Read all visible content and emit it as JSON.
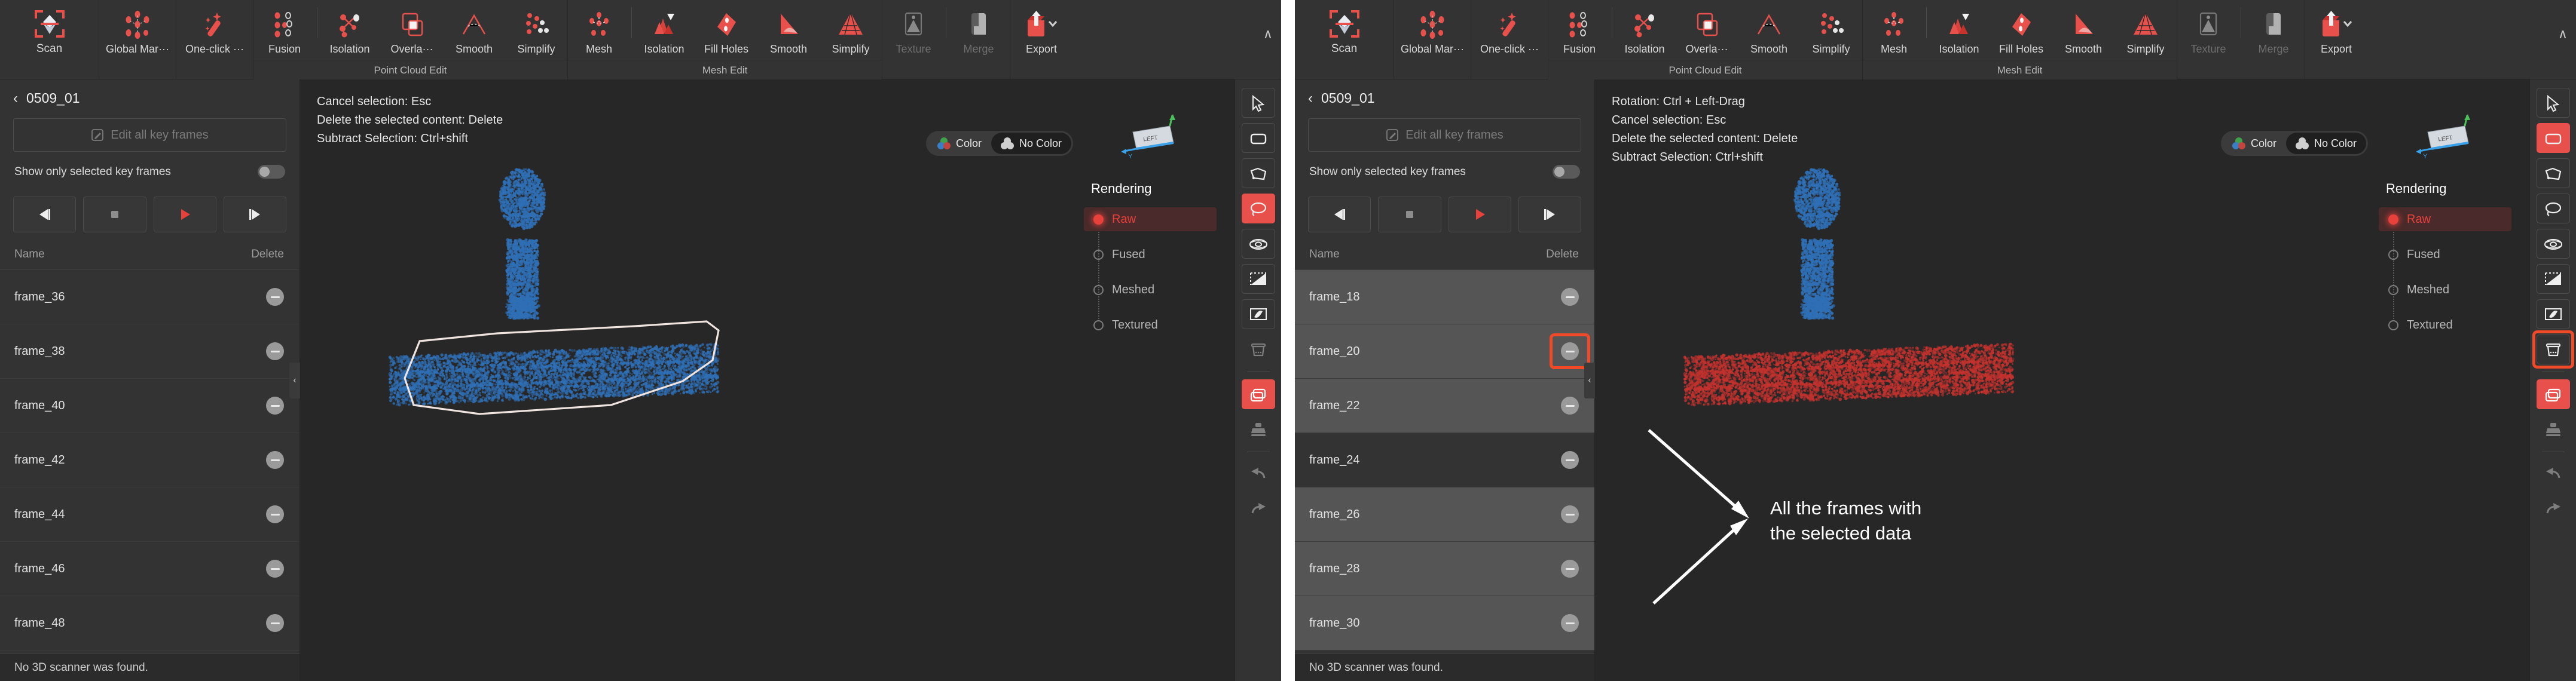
{
  "app": {
    "ribbon": {
      "scan": {
        "label": "Scan",
        "icon": "scan-frame-icon"
      },
      "groups": [
        {
          "caption": "",
          "items": [
            {
              "label": "Global Mar···",
              "icon": "global-marker-icon",
              "disabled": false
            },
            {
              "label": "One-click ···",
              "icon": "magic-wand-icon",
              "disabled": false
            }
          ]
        },
        {
          "caption": "Point Cloud Edit",
          "items": [
            {
              "label": "Fusion",
              "icon": "fusion-points-icon",
              "disabled": false,
              "sep_after": true
            },
            {
              "label": "Isolation",
              "icon": "isolation-nodes-icon",
              "disabled": false
            },
            {
              "label": "Overla···",
              "icon": "overlap-squares-icon",
              "disabled": false
            },
            {
              "label": "Smooth",
              "icon": "smooth-peak-icon",
              "disabled": false
            },
            {
              "label": "Simplify",
              "icon": "simplify-dots-icon",
              "disabled": false
            }
          ]
        },
        {
          "caption": "Mesh Edit",
          "items": [
            {
              "label": "Mesh",
              "icon": "mesh-points-icon",
              "disabled": false,
              "sep_after": true
            },
            {
              "label": "Isolation",
              "icon": "mesh-isolation-icon",
              "disabled": false
            },
            {
              "label": "Fill Holes",
              "icon": "fill-holes-icon",
              "disabled": false
            },
            {
              "label": "Smooth",
              "icon": "mesh-smooth-icon",
              "disabled": false
            },
            {
              "label": "Simplify",
              "icon": "mesh-simplify-icon",
              "disabled": false
            }
          ]
        },
        {
          "caption": "",
          "items": [
            {
              "label": "Texture",
              "icon": "texture-icon",
              "disabled": true,
              "sep_after": true
            },
            {
              "label": "Merge",
              "icon": "merge-icon",
              "disabled": true
            }
          ]
        },
        {
          "caption": "",
          "items": [
            {
              "label": "Export",
              "icon": "export-icon",
              "disabled": false,
              "has_caret": true
            }
          ]
        }
      ],
      "collapse_icon": "chevron-up-icon"
    },
    "accent_red": "#e8413c",
    "highlight_orange": "#f04a28"
  },
  "left": {
    "panel": {
      "title": "0509_01",
      "back_icon": "chevron-left-icon",
      "edit_all_label": "Edit all key frames",
      "edit_all_icon": "pencil-square-icon",
      "toggle_label": "Show only selected key frames",
      "toggle_on": false,
      "transport": [
        {
          "name": "step-back-button",
          "icon": "step-backward-icon"
        },
        {
          "name": "stop-button",
          "icon": "stop-square-icon"
        },
        {
          "name": "play-button",
          "icon": "play-triangle-icon"
        },
        {
          "name": "step-forward-button",
          "icon": "step-forward-icon"
        }
      ],
      "columns": {
        "name": "Name",
        "delete": "Delete"
      },
      "rows": [
        {
          "name": "frame_36",
          "selected": false
        },
        {
          "name": "frame_38",
          "selected": false
        },
        {
          "name": "frame_40",
          "selected": false
        },
        {
          "name": "frame_42",
          "selected": false
        },
        {
          "name": "frame_44",
          "selected": false
        },
        {
          "name": "frame_46",
          "selected": false
        },
        {
          "name": "frame_48",
          "selected": false
        }
      ],
      "status": "No 3D scanner was found."
    },
    "viewport": {
      "hints": [
        "Cancel selection: Esc",
        "Delete the selected content: Delete",
        "Subtract Selection: Ctrl+shift"
      ],
      "color_toggle": {
        "color_label": "Color",
        "nocolor_label": "No Color",
        "active": "No Color"
      },
      "gizmo_label": "LEFT",
      "rendering": {
        "title": "Rendering",
        "options": [
          {
            "label": "Raw",
            "selected": true
          },
          {
            "label": "Fused",
            "selected": false
          },
          {
            "label": "Meshed",
            "selected": false
          },
          {
            "label": "Textured",
            "selected": false
          }
        ]
      },
      "point_cloud_color": "#2f6fb5",
      "lasso_visible": true
    },
    "vbar": [
      {
        "name": "cursor-select-tool",
        "icon": "cursor-arrow-icon",
        "state": "normal"
      },
      {
        "name": "rectangle-select-tool",
        "icon": "rectangle-icon",
        "state": "normal"
      },
      {
        "name": "polygon-select-tool",
        "icon": "polygon-icon",
        "state": "normal"
      },
      {
        "name": "lasso-select-tool",
        "icon": "lasso-icon",
        "state": "active"
      },
      {
        "name": "brush-select-tool",
        "icon": "brush-ellipse-icon",
        "state": "normal"
      },
      {
        "name": "plane-cut-tool",
        "icon": "plane-cut-icon",
        "state": "normal"
      },
      {
        "name": "flip-tool",
        "icon": "flip-icon",
        "state": "normal"
      },
      {
        "name": "delete-tool",
        "icon": "trash-icon",
        "state": "disabled"
      },
      {
        "name": "frames-panel-toggle",
        "icon": "stacked-frames-icon",
        "state": "active"
      },
      {
        "name": "stamp-tool",
        "icon": "stamp-icon",
        "state": "disabled"
      },
      {
        "name": "undo-button",
        "icon": "undo-arrow-icon",
        "state": "disabled"
      },
      {
        "name": "redo-button",
        "icon": "redo-arrow-icon",
        "state": "disabled"
      }
    ]
  },
  "right": {
    "panel": {
      "title": "0509_01",
      "back_icon": "chevron-left-icon",
      "edit_all_label": "Edit all key frames",
      "edit_all_icon": "pencil-square-icon",
      "toggle_label": "Show only selected key frames",
      "toggle_on": false,
      "transport": [
        {
          "name": "step-back-button",
          "icon": "step-backward-icon"
        },
        {
          "name": "stop-button",
          "icon": "stop-square-icon"
        },
        {
          "name": "play-button",
          "icon": "play-triangle-icon"
        },
        {
          "name": "step-forward-button",
          "icon": "step-forward-icon"
        }
      ],
      "columns": {
        "name": "Name",
        "delete": "Delete"
      },
      "rows": [
        {
          "name": "frame_18",
          "selected": true
        },
        {
          "name": "frame_20",
          "selected": true,
          "delete_highlighted": true
        },
        {
          "name": "frame_22",
          "selected": true
        },
        {
          "name": "frame_24",
          "selected": false
        },
        {
          "name": "frame_26",
          "selected": true
        },
        {
          "name": "frame_28",
          "selected": true
        },
        {
          "name": "frame_30",
          "selected": true
        }
      ],
      "status": "No 3D scanner was found."
    },
    "viewport": {
      "hints": [
        "Rotation: Ctrl + Left-Drag",
        "Cancel selection: Esc",
        "Delete the selected content: Delete",
        "Subtract Selection: Ctrl+shift"
      ],
      "color_toggle": {
        "color_label": "Color",
        "nocolor_label": "No Color",
        "active": "No Color"
      },
      "gizmo_label": "LEFT",
      "rendering": {
        "title": "Rendering",
        "options": [
          {
            "label": "Raw",
            "selected": true
          },
          {
            "label": "Fused",
            "selected": false
          },
          {
            "label": "Meshed",
            "selected": false
          },
          {
            "label": "Textured",
            "selected": false
          }
        ]
      },
      "point_cloud_color_head": "#2f6fb5",
      "point_cloud_color_selected": "#c4322e",
      "lasso_visible": false
    },
    "vbar": [
      {
        "name": "cursor-select-tool",
        "icon": "cursor-arrow-icon",
        "state": "normal"
      },
      {
        "name": "rectangle-select-tool",
        "icon": "rectangle-icon",
        "state": "active"
      },
      {
        "name": "polygon-select-tool",
        "icon": "polygon-icon",
        "state": "normal"
      },
      {
        "name": "lasso-select-tool",
        "icon": "lasso-icon",
        "state": "normal"
      },
      {
        "name": "brush-select-tool",
        "icon": "brush-ellipse-icon",
        "state": "normal"
      },
      {
        "name": "plane-cut-tool",
        "icon": "plane-cut-icon",
        "state": "normal"
      },
      {
        "name": "flip-tool",
        "icon": "flip-icon",
        "state": "normal"
      },
      {
        "name": "delete-tool",
        "icon": "trash-icon",
        "state": "normal",
        "highlighted": true
      },
      {
        "name": "frames-panel-toggle",
        "icon": "stacked-frames-icon",
        "state": "active"
      },
      {
        "name": "stamp-tool",
        "icon": "stamp-icon",
        "state": "disabled"
      },
      {
        "name": "undo-button",
        "icon": "undo-arrow-icon",
        "state": "disabled"
      },
      {
        "name": "redo-button",
        "icon": "redo-arrow-icon",
        "state": "disabled"
      }
    ],
    "annotation": {
      "line1": "All the frames with",
      "line2": "the selected data"
    }
  }
}
